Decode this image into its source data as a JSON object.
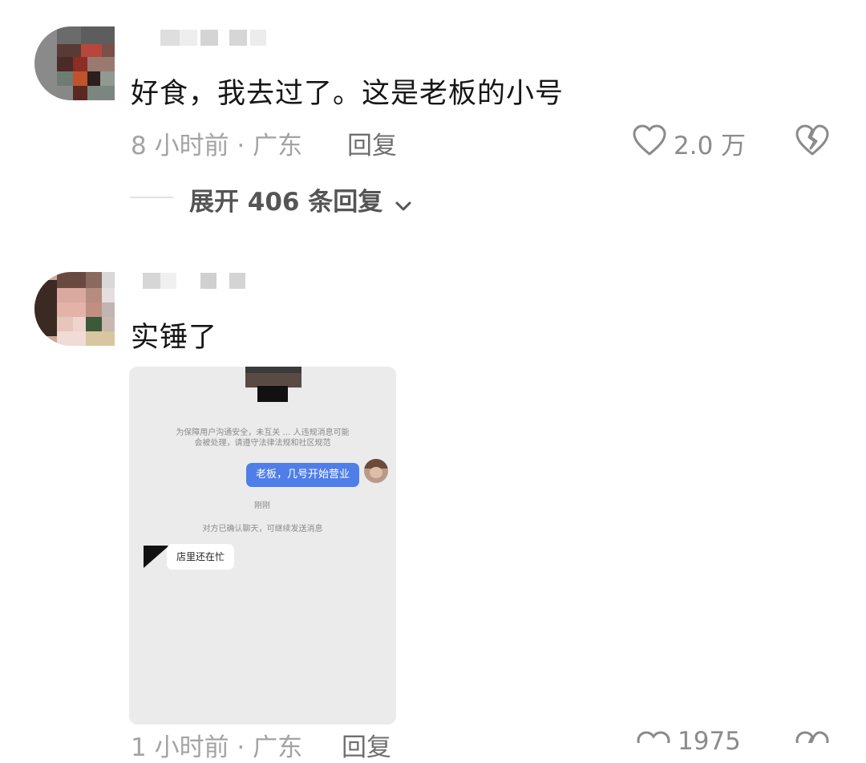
{
  "comments": [
    {
      "text": "好食，我去过了。这是老板的小号",
      "time_location": "8 小时前 · 广东",
      "reply_label": "回复",
      "like_count": "2.0 万",
      "expand_label": "展开 406 条回复"
    },
    {
      "text": "实锤了",
      "time_location": "1 小时前 · 广东",
      "reply_label": "回复",
      "like_count": "1975"
    }
  ],
  "screenshot": {
    "notice_line1": "为保障用户沟通安全，未互关 … 人违规消息可能",
    "notice_line2": "会被处理，请遵守法律法规和社区规范",
    "my_message": "老板，几号开始营业",
    "timestamp": "刚刚",
    "confirm_notice": "对方已确认聊天，可继续发送消息",
    "their_message": "店里还在忙"
  },
  "icons": {
    "like": "heart-outline-icon",
    "dislike": "broken-heart-icon",
    "expand": "chevron-down-icon"
  },
  "colors": {
    "text_primary": "#161616",
    "text_meta": "#a3a3a3",
    "bubble_me": "#4f7ee8",
    "chat_bg": "#ebebeb"
  }
}
